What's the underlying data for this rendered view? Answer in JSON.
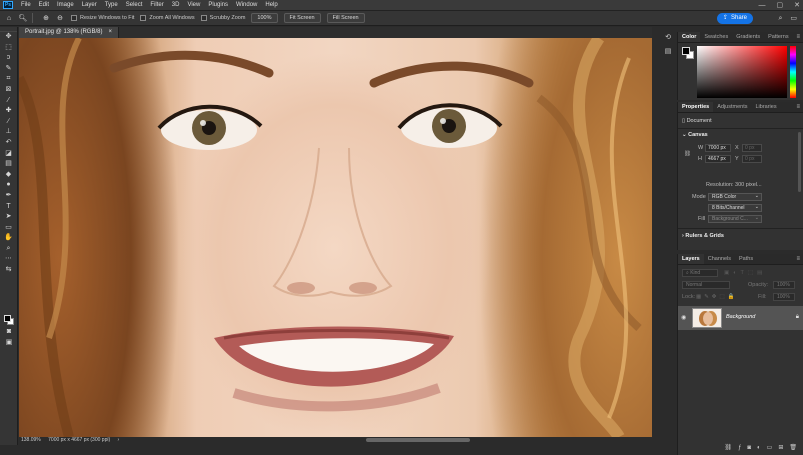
{
  "menubar": {
    "logo": "Ps",
    "items": [
      "File",
      "Edit",
      "Image",
      "Layer",
      "Type",
      "Select",
      "Filter",
      "3D",
      "View",
      "Plugins",
      "Window",
      "Help"
    ],
    "window_controls": [
      "—",
      "▢",
      "✕"
    ]
  },
  "options": {
    "checkboxes": [
      "Resize Windows to Fit",
      "Zoom All Windows",
      "Scrubby Zoom"
    ],
    "zoom_value": "100%",
    "fit_screen": "Fit Screen",
    "fill_screen": "Fill Screen",
    "share_label": "Share"
  },
  "document": {
    "tab_title": "Portrait.jpg @ 138% (RGB/8)",
    "tab_close": "×"
  },
  "status": {
    "zoom": "138.09%",
    "info": "7000 px x 4667 px (300 ppi)"
  },
  "color_panel": {
    "tabs": [
      "Color",
      "Swatches",
      "Gradients",
      "Patterns"
    ],
    "foreground": "#000000",
    "background": "#ffffff"
  },
  "properties_panel": {
    "tabs": [
      "Properties",
      "Adjustments",
      "Libraries"
    ],
    "doc_label": "Document",
    "canvas_header": "Canvas",
    "w_label": "W",
    "w_value": "7000 px",
    "h_label": "H",
    "h_value": "4667 px",
    "x_label": "X",
    "x_value": "0 px",
    "y_label": "Y",
    "y_value": "0 px",
    "resolution": "Resolution: 300 pixel...",
    "mode_label": "Mode",
    "mode_value": "RGB Color",
    "depth_value": "8 Bits/Channel",
    "fill_label": "Fill",
    "fill_value": "Background C...",
    "rulers_header": "Rulers & Grids"
  },
  "layers_panel": {
    "tabs": [
      "Layers",
      "Channels",
      "Paths"
    ],
    "kind_placeholder": "Kind",
    "blend_mode": "Normal",
    "opacity_label": "Opacity:",
    "opacity_value": "100%",
    "lock_label": "Lock:",
    "fill_label": "Fill:",
    "fill_value": "100%",
    "layer_name": "Background"
  }
}
